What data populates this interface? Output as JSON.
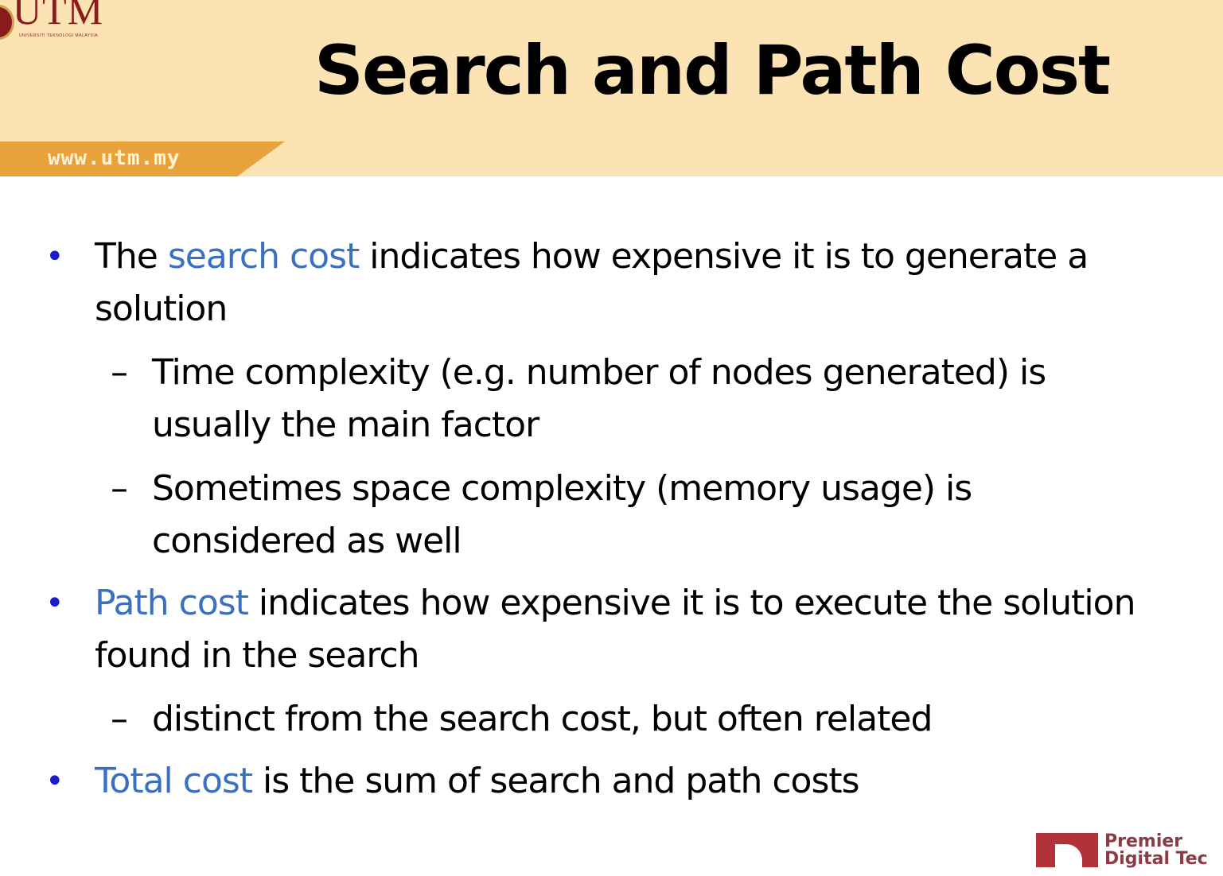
{
  "header": {
    "logo_word": "UTM",
    "logo_sub": "UNIVERSITI TEKNOLOGI MALAYSIA",
    "url": "www.utm.my",
    "title": "Search and Path Cost"
  },
  "colors": {
    "header_bg": "#fbe3b3",
    "url_band": "#e7a23b",
    "highlight": "#3a70c0",
    "bullet_dot": "#1a1acc"
  },
  "bullets": [
    {
      "pre": "The ",
      "highlight": "search cost",
      "post": " indicates how expensive it is to generate a solution",
      "subs": [
        "Time complexity (e.g. number of nodes generated) is usually the main factor",
        "Sometimes space complexity (memory usage) is considered as well"
      ]
    },
    {
      "pre": "",
      "highlight": "Path cost",
      "post": " indicates how expensive it is to execute the solution found in the search",
      "subs": [
        "distinct from the search cost, but often related"
      ]
    },
    {
      "pre": "",
      "highlight": "Total cost",
      "post": " is the sum of search and path costs",
      "subs": []
    }
  ],
  "markers": {
    "bullet": "•",
    "dash": "–"
  },
  "footer": {
    "line1": "Premier",
    "line2": "Digital Tec"
  }
}
